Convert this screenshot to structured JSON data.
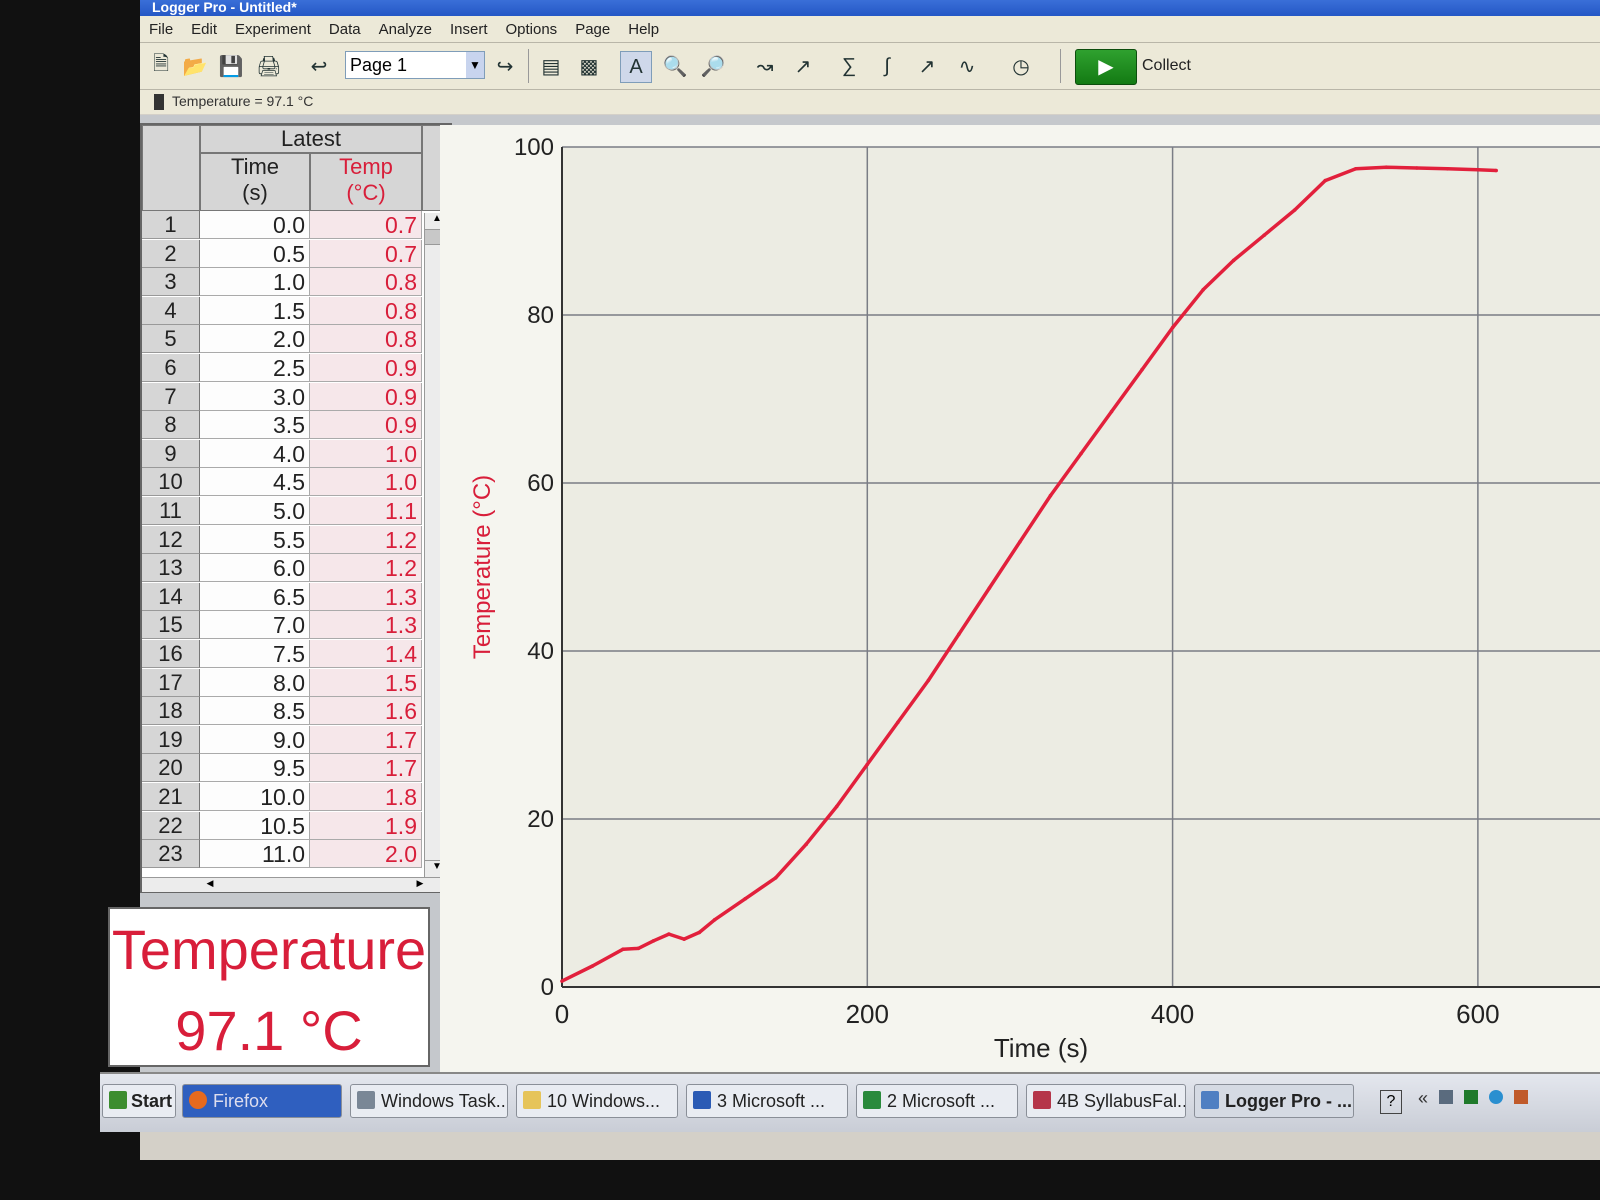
{
  "window": {
    "title": "Logger Pro - Untitled*"
  },
  "menu": [
    "File",
    "Edit",
    "Experiment",
    "Data",
    "Analyze",
    "Insert",
    "Options",
    "Page",
    "Help"
  ],
  "toolbar": {
    "page_select": "Page 1",
    "collect_label": "Collect"
  },
  "sensor_status": "Temperature = 97.1 °C",
  "table": {
    "group": "Latest",
    "time_header": "Time",
    "time_unit": "(s)",
    "temp_header": "Temp",
    "temp_unit": "(°C)",
    "rows": [
      {
        "n": "1",
        "t": "0.0",
        "c": "0.7"
      },
      {
        "n": "2",
        "t": "0.5",
        "c": "0.7"
      },
      {
        "n": "3",
        "t": "1.0",
        "c": "0.8"
      },
      {
        "n": "4",
        "t": "1.5",
        "c": "0.8"
      },
      {
        "n": "5",
        "t": "2.0",
        "c": "0.8"
      },
      {
        "n": "6",
        "t": "2.5",
        "c": "0.9"
      },
      {
        "n": "7",
        "t": "3.0",
        "c": "0.9"
      },
      {
        "n": "8",
        "t": "3.5",
        "c": "0.9"
      },
      {
        "n": "9",
        "t": "4.0",
        "c": "1.0"
      },
      {
        "n": "10",
        "t": "4.5",
        "c": "1.0"
      },
      {
        "n": "11",
        "t": "5.0",
        "c": "1.1"
      },
      {
        "n": "12",
        "t": "5.5",
        "c": "1.2"
      },
      {
        "n": "13",
        "t": "6.0",
        "c": "1.2"
      },
      {
        "n": "14",
        "t": "6.5",
        "c": "1.3"
      },
      {
        "n": "15",
        "t": "7.0",
        "c": "1.3"
      },
      {
        "n": "16",
        "t": "7.5",
        "c": "1.4"
      },
      {
        "n": "17",
        "t": "8.0",
        "c": "1.5"
      },
      {
        "n": "18",
        "t": "8.5",
        "c": "1.6"
      },
      {
        "n": "19",
        "t": "9.0",
        "c": "1.7"
      },
      {
        "n": "20",
        "t": "9.5",
        "c": "1.7"
      },
      {
        "n": "21",
        "t": "10.0",
        "c": "1.8"
      },
      {
        "n": "22",
        "t": "10.5",
        "c": "1.9"
      },
      {
        "n": "23",
        "t": "11.0",
        "c": "2.0"
      }
    ]
  },
  "meter": {
    "label": "Temperature",
    "value": "97.1 °C"
  },
  "chart_data": {
    "type": "line",
    "xlabel": "Time (s)",
    "ylabel": "Temperature (°C)",
    "xlim": [
      0,
      680
    ],
    "ylim": [
      0,
      100
    ],
    "xticks": [
      0,
      200,
      400,
      600
    ],
    "yticks": [
      0,
      20,
      40,
      60,
      80,
      100
    ],
    "grid": true,
    "series": [
      {
        "color": "#e2203c",
        "x": [
          0,
          20,
          40,
          50,
          60,
          70,
          80,
          90,
          100,
          120,
          140,
          160,
          180,
          200,
          220,
          240,
          260,
          280,
          300,
          320,
          340,
          360,
          380,
          400,
          420,
          440,
          460,
          480,
          500,
          520,
          540,
          560,
          580,
          600,
          612
        ],
        "y": [
          0.7,
          2.5,
          4.5,
          4.6,
          5.5,
          6.3,
          5.7,
          6.5,
          8.0,
          10.5,
          13.0,
          17.0,
          21.5,
          26.5,
          31.5,
          36.5,
          42.0,
          47.5,
          53.0,
          58.5,
          63.5,
          68.5,
          73.5,
          78.5,
          83.0,
          86.5,
          89.5,
          92.5,
          96.0,
          97.4,
          97.6,
          97.5,
          97.4,
          97.3,
          97.2
        ]
      }
    ]
  },
  "taskbar": {
    "start": "Start",
    "items": [
      "Firefox",
      "Windows Task...",
      "10 Windows...",
      "3 Microsoft ...",
      "2 Microsoft ...",
      "4B SyllabusFal...",
      "Logger Pro - ..."
    ]
  }
}
